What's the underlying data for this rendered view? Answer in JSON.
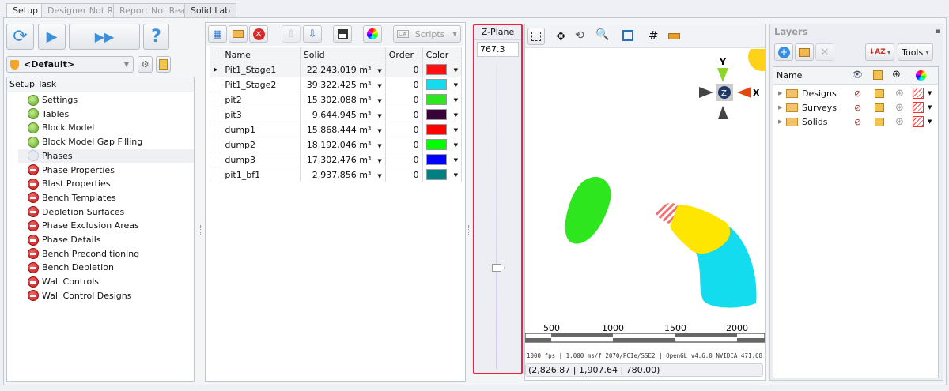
{
  "tabs": [
    "Setup",
    "Designer Not Ready",
    "Report Not Ready",
    "Solid Lab"
  ],
  "profile": {
    "value": "<Default>"
  },
  "setup": {
    "header": "Setup Task",
    "items": [
      {
        "label": "Settings",
        "status": "done"
      },
      {
        "label": "Tables",
        "status": "done"
      },
      {
        "label": "Block Model",
        "status": "done"
      },
      {
        "label": "Block Model Gap Filling",
        "status": "done"
      },
      {
        "label": "Phases",
        "status": "pending"
      },
      {
        "label": "Phase Properties",
        "status": "blocked"
      },
      {
        "label": "Blast Properties",
        "status": "blocked"
      },
      {
        "label": "Bench Templates",
        "status": "blocked"
      },
      {
        "label": "Depletion Surfaces",
        "status": "blocked"
      },
      {
        "label": "Phase Exclusion Areas",
        "status": "blocked"
      },
      {
        "label": "Phase Details",
        "status": "blocked"
      },
      {
        "label": "Bench Preconditioning",
        "status": "blocked"
      },
      {
        "label": "Bench Depletion",
        "status": "blocked"
      },
      {
        "label": "Wall Controls",
        "status": "blocked"
      },
      {
        "label": "Wall Control Designs",
        "status": "blocked"
      }
    ]
  },
  "solids": {
    "scripts_label": "Scripts",
    "columns": [
      "Name",
      "Solid",
      "Order",
      "Color"
    ],
    "rows": [
      {
        "name": "Pit1_Stage1",
        "solid": "22,243,019 m³",
        "order": "0",
        "color": "#ff0f0f"
      },
      {
        "name": "Pit1_Stage2",
        "solid": "39,322,425 m³",
        "order": "0",
        "color": "#12dced"
      },
      {
        "name": "pit2",
        "solid": "15,302,088 m³",
        "order": "0",
        "color": "#2ee61e"
      },
      {
        "name": "pit3",
        "solid": "9,644,945 m³",
        "order": "0",
        "color": "#3a0038"
      },
      {
        "name": "dump1",
        "solid": "15,868,444 m³",
        "order": "0",
        "color": "#ff0000"
      },
      {
        "name": "dump2",
        "solid": "18,192,046 m³",
        "order": "0",
        "color": "#00ff00"
      },
      {
        "name": "dump3",
        "solid": "17,302,476 m³",
        "order": "0",
        "color": "#0000ff"
      },
      {
        "name": "pit1_bf1",
        "solid": "2,937,856 m³",
        "order": "0",
        "color": "#008080"
      }
    ]
  },
  "zplane": {
    "title": "Z-Plane",
    "value": "767.3"
  },
  "viewer": {
    "axis_y": "Y",
    "axis_x": "X",
    "axis_z": "Z",
    "scale": [
      "500",
      "1000",
      "1500",
      "2000"
    ],
    "status": "1000 fps | 1.000 ms/f 2070/PCIe/SSE2 | OpenGL v4.6.0 NVIDIA 471.68",
    "coords": "(2,826.87 | 1,907.64 | 780.00)"
  },
  "layers": {
    "title": "Layers",
    "tools_label": "Tools",
    "name_header": "Name",
    "items": [
      "Designs",
      "Surveys",
      "Solids"
    ]
  }
}
